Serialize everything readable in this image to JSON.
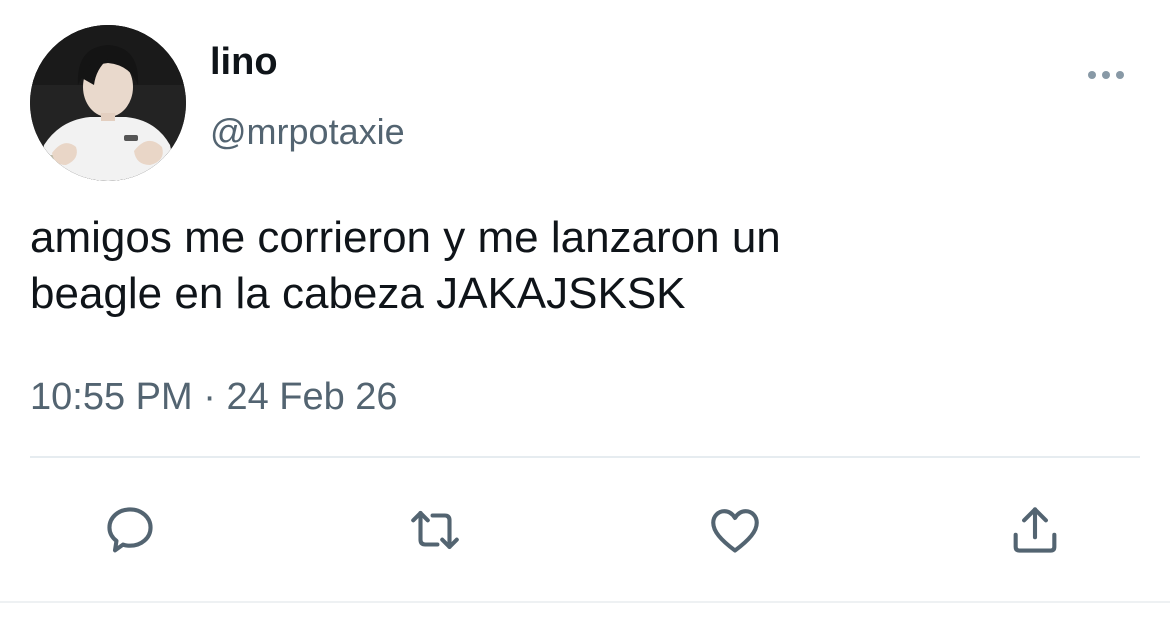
{
  "user": {
    "display_name": "lino",
    "handle": "@mrpotaxie"
  },
  "tweet": {
    "text_lines": [
      "amigos me corrieron y me lanzaron un",
      "beagle en la cabeza JAKAJSKSK"
    ],
    "time": "10:55 PM",
    "separator": "·",
    "date": "24 Feb 26"
  },
  "icons": {
    "more": "more-dots-icon",
    "reply": "reply-icon",
    "retweet": "retweet-icon",
    "like": "heart-icon",
    "share": "share-icon"
  },
  "colors": {
    "primary_text": "#0f1419",
    "secondary_text": "#536471",
    "icon": "#536471",
    "divider": "#e6ecf0"
  }
}
